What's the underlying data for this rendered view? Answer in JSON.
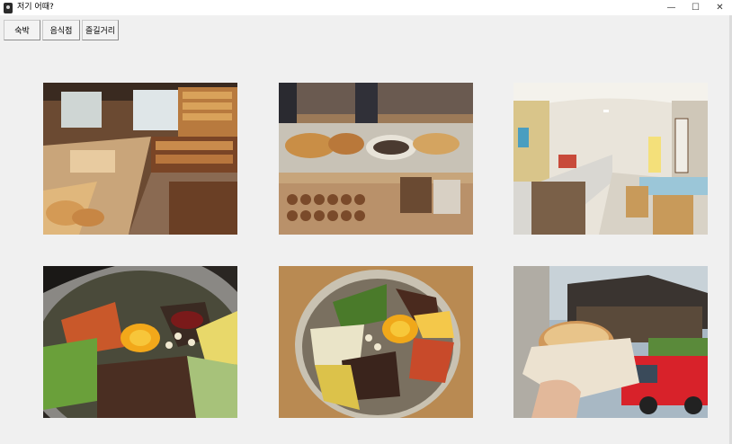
{
  "window": {
    "title": "저기 어때?",
    "icon": "app-icon",
    "controls": {
      "minimize": "—",
      "maximize": "☐",
      "close": "✕"
    }
  },
  "toolbar": {
    "buttons": [
      {
        "label": "숙박"
      },
      {
        "label": "음식점"
      },
      {
        "label": "즐길거리"
      }
    ]
  },
  "gallery": {
    "images": [
      {
        "subject": "bakery-interior-photo"
      },
      {
        "subject": "pastry-display-case-photo"
      },
      {
        "subject": "cafeteria-interior-photo"
      },
      {
        "subject": "bibimbap-bowl-photo"
      },
      {
        "subject": "bibimbap-brass-bowl-photo"
      },
      {
        "subject": "hand-holding-bread-street-photo"
      }
    ]
  }
}
